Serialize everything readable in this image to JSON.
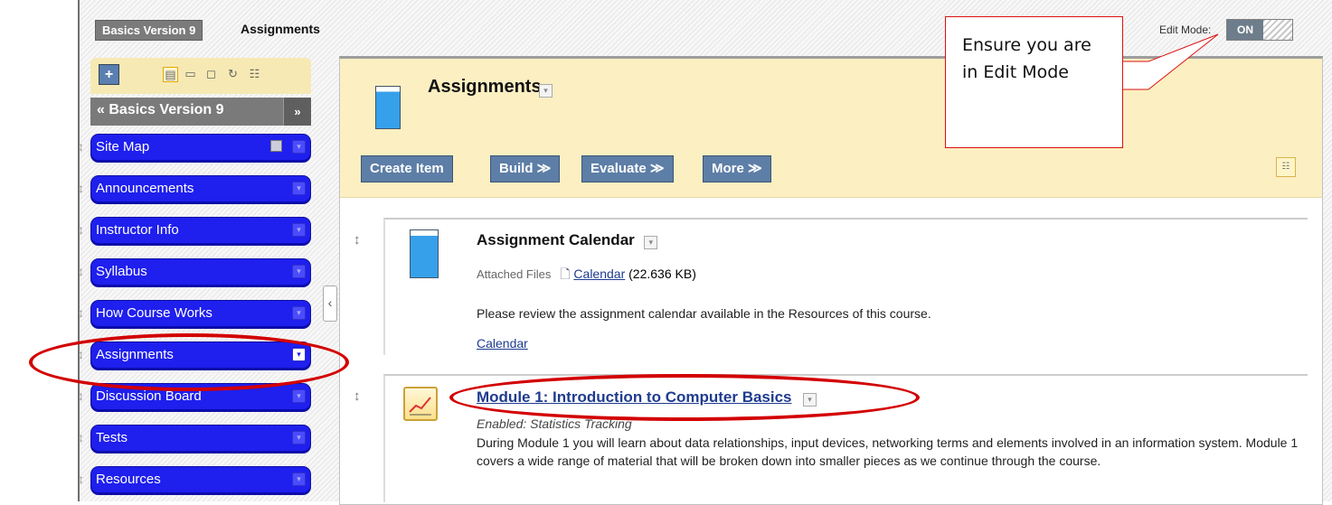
{
  "breadcrumb": {
    "course": "Basics Version 9",
    "current": "Assignments"
  },
  "edit_mode": {
    "label": "Edit Mode:",
    "state": "ON"
  },
  "menu": {
    "add_label": "+",
    "header": "Basics Version 9",
    "header_prefix": "«",
    "collapse_label": "»",
    "items": [
      {
        "label": "Site Map"
      },
      {
        "label": "Announcements"
      },
      {
        "label": "Instructor Info"
      },
      {
        "label": "Syllabus"
      },
      {
        "label": "How Course Works"
      },
      {
        "label": "Assignments"
      },
      {
        "label": "Discussion Board"
      },
      {
        "label": "Tests"
      },
      {
        "label": "Resources"
      }
    ]
  },
  "page": {
    "title": "Assignments",
    "buttons": {
      "create": "Create Item",
      "build": "Build",
      "evaluate": "Evaluate",
      "more": "More"
    }
  },
  "items": [
    {
      "title": "Assignment Calendar",
      "attached_label": "Attached Files",
      "file_name": "Calendar",
      "file_size": "(22.636 KB)",
      "description": "Please review the assignment calendar available in the Resources of this course.",
      "link": "Calendar"
    },
    {
      "title": "Module 1: Introduction to Computer Basics",
      "status": "Enabled: Statistics Tracking",
      "description": "During Module 1 you will learn about data relationships, input devices, networking terms and elements involved in an information system.  Module 1 covers a wide range of material that will be broken down into smaller pieces as we continue through the course."
    }
  ],
  "callout": {
    "text": "Ensure you are in Edit Mode"
  },
  "colors": {
    "menu_blue": "#1f1fee",
    "button_blue": "#5d7ea6",
    "header_yellow": "#fcefc2",
    "annotation_red": "#d30000"
  }
}
